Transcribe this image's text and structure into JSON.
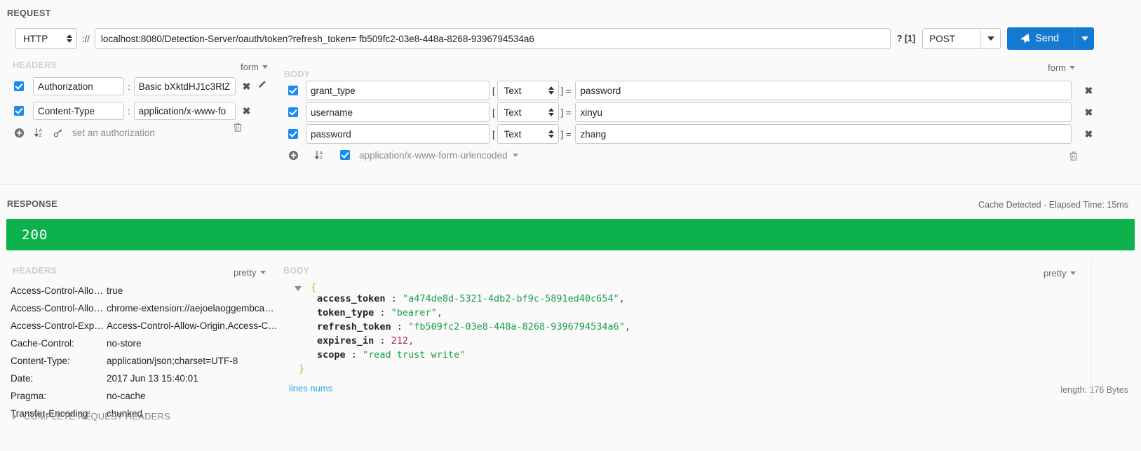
{
  "request": {
    "title": "REQUEST",
    "protocol": "HTTP",
    "protocol_sep": "://",
    "url": "localhost:8080/Detection-Server/oauth/token?refresh_token= fb509fc2-03e8-448a-8268-9396794534a6",
    "query_indicator": "? [1]",
    "method": "POST",
    "send_label": "Send",
    "headers_label": "HEADERS",
    "headers_mode": "form",
    "body_label": "BODY",
    "body_mode": "form",
    "headers": [
      {
        "enabled": true,
        "name": "Authorization",
        "separator": ":",
        "value": "Basic bXktdHJ1c3RlZ",
        "has_edit": true
      },
      {
        "enabled": true,
        "name": "Content-Type",
        "separator": ":",
        "value": "application/x-www-fo",
        "has_edit": false
      }
    ],
    "headers_footer": {
      "auth_link": "set an authorization"
    },
    "body_params": [
      {
        "enabled": true,
        "key": "grant_type",
        "type": "Text",
        "value": "password"
      },
      {
        "enabled": true,
        "key": "username",
        "type": "Text",
        "value": "xinyu"
      },
      {
        "enabled": true,
        "key": "password",
        "type": "Text",
        "value": "zhang"
      }
    ],
    "body_footer": {
      "enabled": true,
      "content_type": "application/x-www-form-urlencoded"
    }
  },
  "response": {
    "title": "RESPONSE",
    "cache_info": "Cache Detected - Elapsed Time: 15ms",
    "status_code": "200",
    "status_color": "#0cb14b",
    "headers_label": "HEADERS",
    "headers_mode": "pretty",
    "body_label": "BODY",
    "body_mode": "pretty",
    "headers": [
      {
        "name": "Access-Control-Allow-Credentials:",
        "value": "true"
      },
      {
        "name": "Access-Control-Allow-Origin:",
        "value": "chrome-extension://aejoelaoggembcahagimdiliamlcdmfm"
      },
      {
        "name": "Access-Control-Expose-Headers:",
        "value": "Access-Control-Allow-Origin,Access-Control-Allow-Credentials"
      },
      {
        "name": "Cache-Control:",
        "value": "no-store"
      },
      {
        "name": "Content-Type:",
        "value": "application/json;charset=UTF-8"
      },
      {
        "name": "Date:",
        "value": "2017 Jun 13 15:40:01"
      },
      {
        "name": "Pragma:",
        "value": "no-cache"
      },
      {
        "name": "Transfer-Encoding:",
        "value": "chunked"
      }
    ],
    "complete_request_headers": "COMPLETE REQUEST HEADERS",
    "body_json": {
      "open_brace": "{",
      "close_brace": "}",
      "fields": [
        {
          "key": "access_token",
          "value": "\"a474de8d-5321-4db2-bf9c-5891ed40c654\"",
          "type": "string",
          "comma": ","
        },
        {
          "key": "token_type",
          "value": "\"bearer\"",
          "type": "string",
          "comma": ","
        },
        {
          "key": "refresh_token",
          "value": "\"fb509fc2-03e8-448a-8268-9396794534a6\"",
          "type": "string",
          "comma": ","
        },
        {
          "key": "expires_in",
          "value": "212",
          "type": "number",
          "comma": ","
        },
        {
          "key": "scope",
          "value": "\"read trust write\"",
          "type": "string",
          "comma": ""
        }
      ]
    },
    "lines_nums_link": "lines nums",
    "length_info": "length: 176 Bytes"
  }
}
